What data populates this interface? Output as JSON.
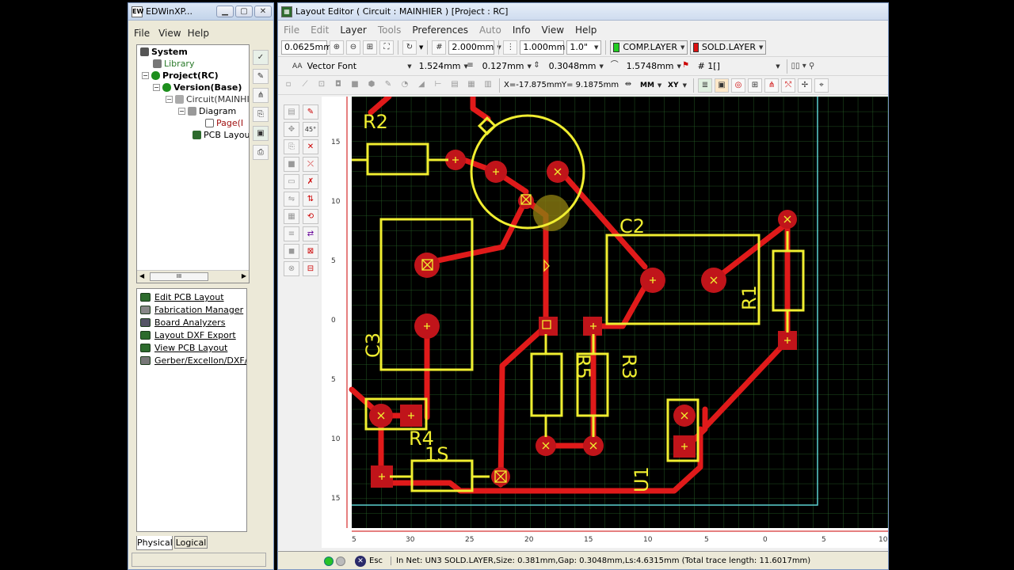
{
  "left_window": {
    "title": "EDWinXP...",
    "menu": [
      "File",
      "View",
      "Help"
    ],
    "tree": [
      {
        "label": "System",
        "bold": true
      },
      {
        "label": "Library"
      },
      {
        "label": "Project(RC)",
        "bold": true
      },
      {
        "label": "Version(Base)",
        "bold": true
      },
      {
        "label": "Circuit(MAINHI"
      },
      {
        "label": "Diagram"
      },
      {
        "label": "Page(I"
      },
      {
        "label": "PCB Layou"
      }
    ],
    "scroll_label": "III",
    "commands": [
      "Edit PCB Layout",
      "Fabrication Manager",
      "Board Analyzers",
      "Layout DXF Export",
      "View PCB Layout",
      "Gerber/Excellon/DXF/..."
    ],
    "tabs": [
      "Physical",
      "Logical"
    ]
  },
  "main_window": {
    "title": "Layout Editor ( Circuit : MAINHIER ) [Project : RC]",
    "menu": [
      "File",
      "Edit",
      "Layer",
      "Tools",
      "Preferences",
      "Auto",
      "Info",
      "View",
      "Help"
    ],
    "toolbar1": {
      "snap": "0.0625mm",
      "grid": "2.000mm",
      "trace_width": "1.000mm",
      "angle": "1.0\"",
      "comp_layer": "COMP.LAYER",
      "sold_layer": "SOLD.LAYER",
      "comp_color": "#22cc22",
      "sold_color": "#dd1111"
    },
    "toolbar2": {
      "font_icon": "AA",
      "font": "Vector Font",
      "text_size": "1.524mm",
      "line_width": "0.127mm",
      "clearance": "0.3048mm",
      "arc": "1.5748mm",
      "net": "# 1[]"
    },
    "toolbar3": {
      "coord_x": "X=-17.875mm",
      "coord_y": "Y= 9.1875mm",
      "units": "MM",
      "mode": "XY"
    },
    "ruler_left": [
      "15",
      "10",
      "5",
      "0",
      "5",
      "10",
      "15"
    ],
    "ruler_bottom": [
      "5",
      "30",
      "25",
      "20",
      "15",
      "10",
      "5",
      "0",
      "5",
      "10"
    ],
    "component_labels": [
      "R2",
      "C2",
      "R1",
      "C3",
      "R5",
      "R3",
      "R4",
      "1S",
      "U1"
    ],
    "status": {
      "esc": "Esc",
      "text": "In Net: UN3 SOLD.LAYER,Size: 0.381mm,Gap: 0.3048mm,Ls:4.6315mm (Total trace length: 11.6017mm)"
    }
  }
}
